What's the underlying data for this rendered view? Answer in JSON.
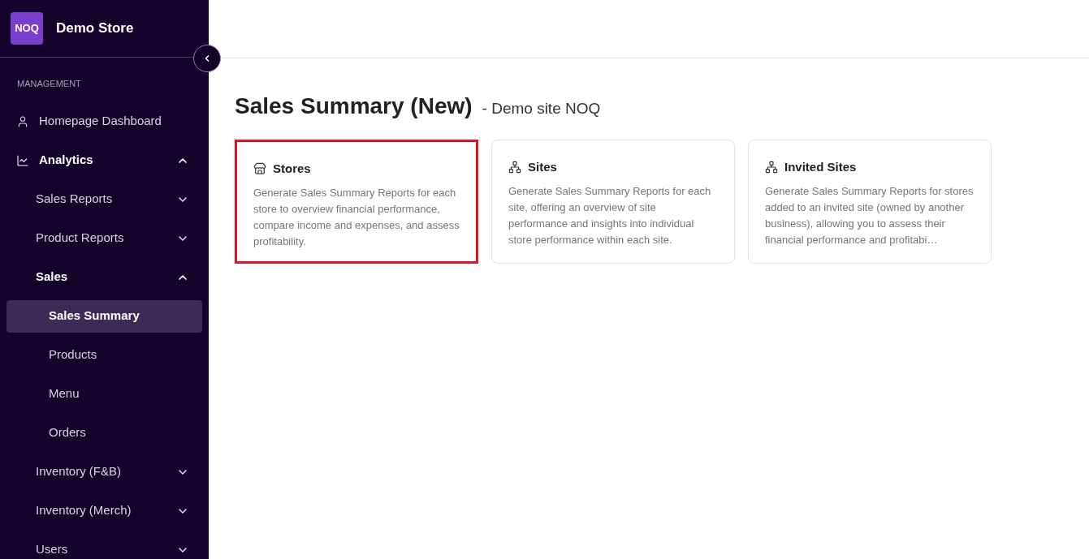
{
  "sidebar": {
    "logo": "NOQ",
    "store_name": "Demo Store",
    "section_label": "MANAGEMENT",
    "items": [
      {
        "label": "Homepage Dashboard",
        "kind": "user",
        "expanded": false,
        "selected": false
      },
      {
        "label": "Analytics",
        "kind": "chart",
        "expanded": true,
        "selected": false,
        "children": [
          {
            "label": "Sales Reports",
            "kind": "group",
            "expanded": false,
            "selected": false
          },
          {
            "label": "Product Reports",
            "kind": "group",
            "expanded": false,
            "selected": false
          },
          {
            "label": "Sales",
            "kind": "group",
            "expanded": true,
            "selected": false,
            "children": [
              {
                "label": "Sales Summary",
                "selected": true
              },
              {
                "label": "Products",
                "selected": false
              },
              {
                "label": "Menu",
                "selected": false
              },
              {
                "label": "Orders",
                "selected": false
              }
            ]
          },
          {
            "label": "Inventory (F&B)",
            "kind": "group",
            "expanded": false,
            "selected": false
          },
          {
            "label": "Inventory (Merch)",
            "kind": "group",
            "expanded": false,
            "selected": false
          },
          {
            "label": "Users",
            "kind": "group",
            "expanded": false,
            "selected": false
          }
        ]
      }
    ]
  },
  "page": {
    "title": "Sales Summary (New)",
    "subtitle": "- Demo site NOQ"
  },
  "cards": [
    {
      "kind": "store",
      "title": "Stores",
      "description": "Generate Sales Summary Reports for each store to overview financial performance, compare income and expenses, and assess profitability.",
      "selected": true
    },
    {
      "kind": "site",
      "title": "Sites",
      "description": "Generate Sales Summary Reports for each site, offering an overview of site performance and insights into individual store performance within each site.",
      "selected": false
    },
    {
      "kind": "site",
      "title": "Invited Sites",
      "description": "Generate Sales Summary Reports for stores added to an invited site (owned by another business), allowing you to assess their financial performance and profitabi…",
      "selected": false
    }
  ]
}
